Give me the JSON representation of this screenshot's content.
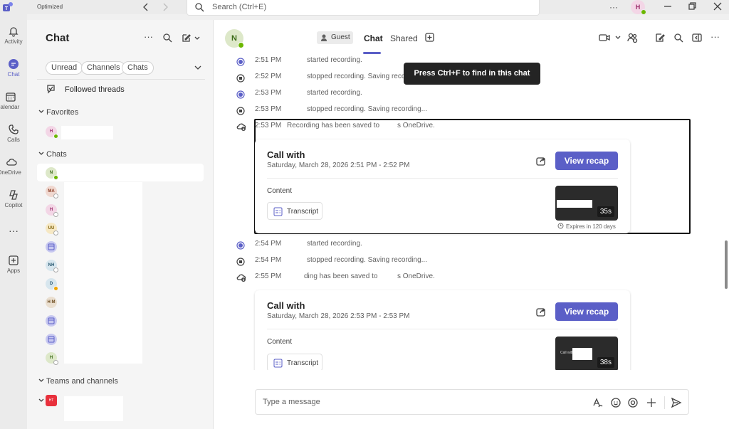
{
  "titlebar": {
    "status": "Optimized",
    "search_placeholder": "Search (Ctrl+E)",
    "avatar_initial": "H"
  },
  "rail": [
    {
      "label": "Activity",
      "icon": "bell-icon"
    },
    {
      "label": "Chat",
      "icon": "chat-icon"
    },
    {
      "label": "Calendar",
      "icon": "calendar-icon"
    },
    {
      "label": "Calls",
      "icon": "phone-icon"
    },
    {
      "label": "OneDrive",
      "icon": "cloud-icon"
    },
    {
      "label": "Copilot",
      "icon": "copilot-icon"
    },
    {
      "label": "Apps",
      "icon": "apps-icon"
    }
  ],
  "chatlist": {
    "title": "Chat",
    "filters": [
      "Unread",
      "Channels",
      "Chats"
    ],
    "followed": "Followed threads",
    "favorites_label": "Favorites",
    "chats_label": "Chats",
    "teams_label": "Teams and channels",
    "favorite_avatar": "H",
    "chat_avatars": [
      "N",
      "MA",
      "H",
      "UU",
      "",
      "NH",
      "D",
      "H M",
      "",
      "",
      "H"
    ],
    "team_avatar": "HT"
  },
  "header": {
    "avatar": "N",
    "guest": "Guest",
    "tabs": [
      "Chat",
      "Shared"
    ]
  },
  "tooltip": "Press Ctrl+F to find in this chat",
  "messages": [
    {
      "time": "2:51 PM",
      "text": "started recording."
    },
    {
      "time": "2:52 PM",
      "text": "stopped recording. Saving reco"
    },
    {
      "time": "2:53 PM",
      "text": "started recording."
    },
    {
      "time": "2:53 PM",
      "text": "stopped recording. Saving recording..."
    },
    {
      "time": "2:53 PM",
      "text": "Recording has been saved to",
      "suffix": "s OneDrive."
    },
    {
      "time": "2:54 PM",
      "text": "started recording."
    },
    {
      "time": "2:54 PM",
      "text": "stopped recording. Saving recording..."
    },
    {
      "time": "2:55 PM",
      "text": "ding has been saved to",
      "suffix": "s OneDrive."
    }
  ],
  "cards": [
    {
      "title": "Call with",
      "date": "Saturday, March 28, 2026 2:51 PM - 2:52 PM",
      "recap": "View recap",
      "content": "Content",
      "transcript": "Transcript",
      "duration": "35s",
      "expires": "Expires in 120 days"
    },
    {
      "title": "Call with",
      "date": "Saturday, March 28, 2026 2:53 PM - 2:53 PM",
      "recap": "View recap",
      "content": "Content",
      "transcript": "Transcript",
      "duration": "38s",
      "thumb_text": "Call with"
    }
  ],
  "compose": {
    "placeholder": "Type a message"
  },
  "colors": {
    "accent": "#5b5fc7",
    "presence": "#6bb700"
  }
}
